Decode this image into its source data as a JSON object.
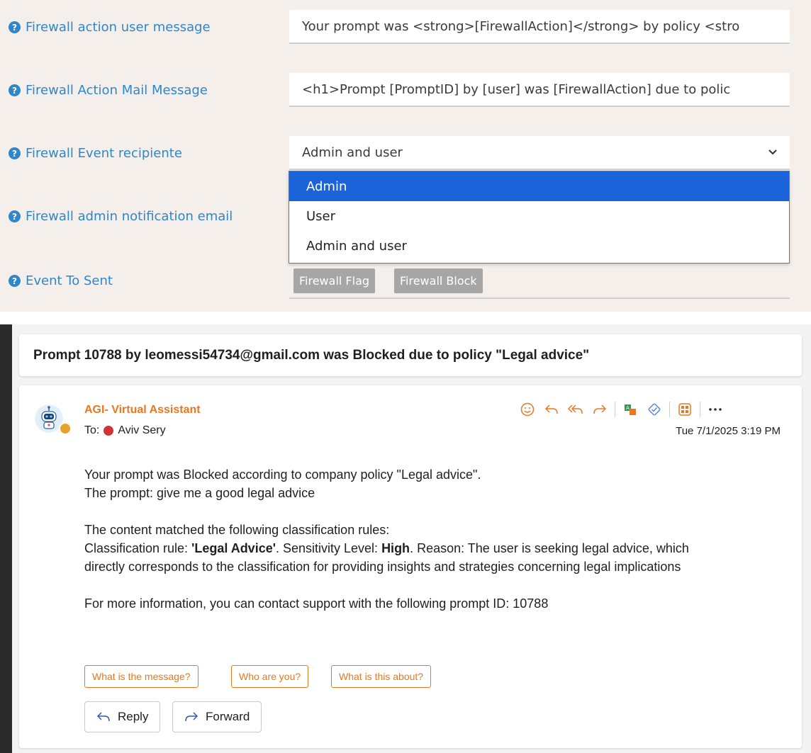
{
  "settings": {
    "rows": [
      {
        "label": "Firewall action user message",
        "value": "Your prompt was <strong>[FirewallAction]</strong> by policy <stro"
      },
      {
        "label": "Firewall Action Mail Message",
        "value": "<h1>Prompt [PromptID] by [user] was [FirewallAction] due to polic"
      },
      {
        "label": "Firewall Event recipiente",
        "value": "Admin and user"
      },
      {
        "label": "Firewall admin notification email"
      },
      {
        "label": "Event To Sent"
      }
    ],
    "dropdown_options": [
      "Admin",
      "User",
      "Admin and user"
    ],
    "dropdown_highlighted": "Admin",
    "event_tags": [
      "Firewall Flag",
      "Firewall Block"
    ]
  },
  "email": {
    "subject": "Prompt 10788 by leomessi54734@gmail.com was Blocked due to policy \"Legal advice\"",
    "sender": "AGI- Virtual Assistant",
    "to_label": "To:",
    "to_name": "Aviv Sery",
    "date": "Tue 7/1/2025 3:19 PM",
    "body": {
      "line1": "Your prompt was Blocked according to company policy \"Legal advice\".",
      "line2": "The prompt: give me a good legal advice",
      "line3": "The content matched the following classification rules:",
      "rule_prefix": "Classification rule: ",
      "rule_name": "'Legal Advice'",
      "sensitivity_prefix": ". Sensitivity Level: ",
      "sensitivity": "High",
      "reason_line1": ". Reason: The user is seeking legal advice, which",
      "reason_line2": "directly corresponds to the classification for providing insights and strategies concerning legal implications",
      "line5": "For more information, you can contact support with the following prompt ID: 10788"
    },
    "suggestions": [
      "What is the message?",
      "Who are you?",
      "What is this about?"
    ],
    "actions": {
      "reply": "Reply",
      "forward": "Forward"
    },
    "toolbar_icons": [
      "smiley-icon",
      "reply-icon",
      "reply-all-icon",
      "forward-icon",
      "translate-icon",
      "sensitivity-icon",
      "apps-icon",
      "more-icon"
    ]
  },
  "colors": {
    "label_blue": "#2f86c9",
    "panel_bg": "#f5efec",
    "selected_option": "#1a63d8",
    "accent_orange": "#e87722",
    "tag_gray": "#a6a6a6"
  }
}
